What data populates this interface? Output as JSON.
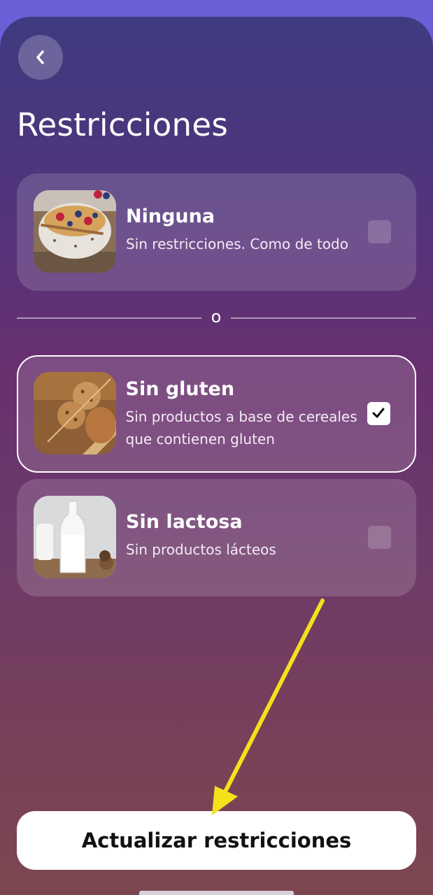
{
  "header": {
    "back_icon": "chevron-left-icon",
    "title": "Restricciones"
  },
  "options": [
    {
      "title": "Ninguna",
      "description": "Sin restricciones. Como de todo",
      "image": "yogurt-bowl-photo",
      "checked": false
    },
    {
      "title": "Sin gluten",
      "description": "Sin productos a base de cereales que contienen gluten",
      "image": "gluten-free-cookies-photo",
      "checked": true
    },
    {
      "title": "Sin lactosa",
      "description": "Sin productos lácteos",
      "image": "milk-bottle-photo",
      "checked": false
    }
  ],
  "divider": {
    "label": "o"
  },
  "footer": {
    "button_label": "Actualizar restricciones"
  },
  "annotation": {
    "type": "yellow-arrow-pointing-to-button",
    "color": "#f5e11b"
  },
  "colors": {
    "background_top": "#3f3a80",
    "background_bottom": "#7d4750",
    "outer_background": "#6a5fd6",
    "button_background": "#ffffff",
    "button_text": "#111111"
  }
}
